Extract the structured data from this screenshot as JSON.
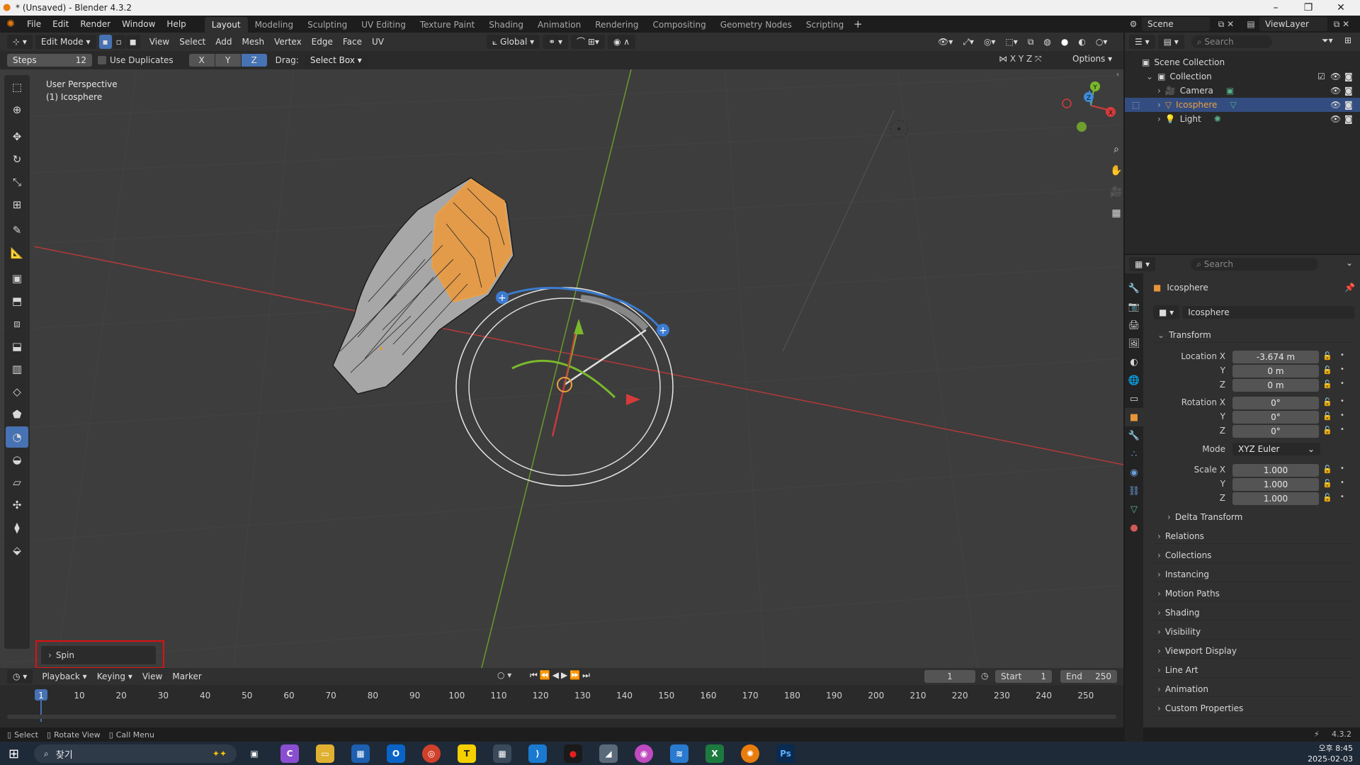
{
  "window": {
    "title": "* (Unsaved) - Blender 4.3.2"
  },
  "menus": [
    "File",
    "Edit",
    "Render",
    "Window",
    "Help"
  ],
  "workspaces": [
    "Layout",
    "Modeling",
    "Sculpting",
    "UV Editing",
    "Texture Paint",
    "Shading",
    "Animation",
    "Rendering",
    "Compositing",
    "Geometry Nodes",
    "Scripting"
  ],
  "active_workspace": "Layout",
  "scene": {
    "name": "Scene",
    "view_layer": "ViewLayer"
  },
  "viewport": {
    "mode": "Edit Mode",
    "menus": [
      "View",
      "Select",
      "Add",
      "Mesh",
      "Vertex",
      "Edge",
      "Face",
      "UV"
    ],
    "orientation": "Global",
    "options_label": "Options",
    "overlay_text": [
      "User Perspective",
      "(1) Icosphere"
    ],
    "axis_labels": {
      "x": "X",
      "y": "Y",
      "z": "Z"
    }
  },
  "tool_options": {
    "steps_label": "Steps",
    "steps_value": "12",
    "use_duplicates_label": "Use Duplicates",
    "axis_x": "X",
    "axis_y": "Y",
    "axis_z": "Z",
    "drag_label": "Drag:",
    "drag_value": "Select Box"
  },
  "operator_panel": {
    "label": "Spin"
  },
  "timeline": {
    "menus": [
      "Playback",
      "Keying",
      "View",
      "Marker"
    ],
    "current_frame": "1",
    "start_label": "Start",
    "start": "1",
    "end_label": "End",
    "end": "250",
    "ticks": [
      "1",
      "10",
      "20",
      "30",
      "40",
      "50",
      "60",
      "70",
      "80",
      "90",
      "100",
      "110",
      "120",
      "130",
      "140",
      "150",
      "160",
      "170",
      "180",
      "190",
      "200",
      "210",
      "220",
      "230",
      "240",
      "250"
    ]
  },
  "statusbar": {
    "select": "Select",
    "rotate": "Rotate View",
    "menu": "Call Menu",
    "version": "4.3.2"
  },
  "outliner": {
    "search_placeholder": "Search",
    "root": "Scene Collection",
    "collection": "Collection",
    "items": [
      "Camera",
      "Icosphere",
      "Light"
    ]
  },
  "properties": {
    "search_placeholder": "Search",
    "object_name": "Icosphere",
    "object_field": "Icosphere",
    "transform_label": "Transform",
    "location_label": "Location X",
    "location": [
      "-3.674 m",
      "0 m",
      "0 m"
    ],
    "rotation_label": "Rotation X",
    "rotation": [
      "0°",
      "0°",
      "0°"
    ],
    "y_label": "Y",
    "z_label": "Z",
    "mode_label": "Mode",
    "mode_value": "XYZ Euler",
    "scale_label": "Scale X",
    "scale": [
      "1.000",
      "1.000",
      "1.000"
    ],
    "delta_label": "Delta Transform",
    "sections": [
      "Relations",
      "Collections",
      "Instancing",
      "Motion Paths",
      "Shading",
      "Visibility",
      "Viewport Display",
      "Line Art",
      "Animation",
      "Custom Properties"
    ]
  },
  "taskbar": {
    "search_label": "찾기",
    "time": "오후 8:45",
    "date": "2025-02-03"
  },
  "colors": {
    "accent": "#4772b3",
    "x_axis": "#d63b3b",
    "y_axis": "#8bc34a",
    "z_axis": "#3d8bd9",
    "selection": "#f0a040",
    "highlight_box": "#e01010"
  }
}
